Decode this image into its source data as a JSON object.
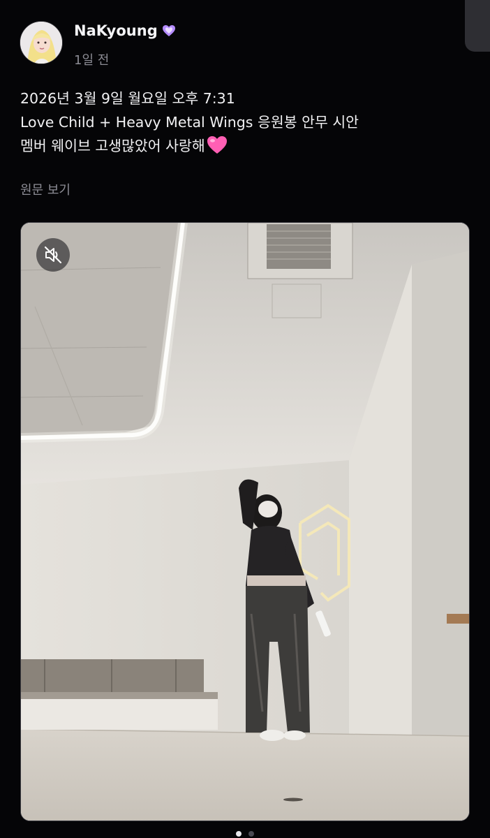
{
  "author": {
    "name": "NaKyoung",
    "badge_icon": "purple-heart-badge-icon",
    "posted_ago": "1일 전"
  },
  "post": {
    "lines": [
      "2026년 3월 9일 월요일 오후 7:31",
      "Love Child + Heavy Metal Wings 응원봉 안무 시안",
      "멤버 웨이브 고생많았어 사랑해"
    ],
    "emoji": "💗",
    "view_original_label": "원문 보기"
  },
  "media": {
    "type": "video",
    "mute_icon": "speaker-muted-icon",
    "muted": true
  },
  "pager": {
    "current": 1,
    "total": 2
  },
  "colors": {
    "background": "#050507",
    "text": "#f2f2f4",
    "muted_text": "#8b8b93",
    "badge": "#b58cff",
    "emoji_heart": "#ff5fb4"
  }
}
